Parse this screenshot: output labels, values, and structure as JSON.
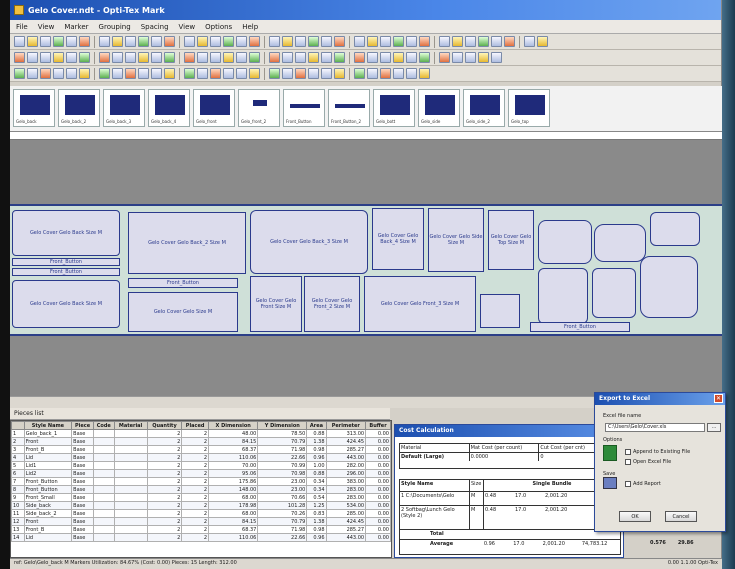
{
  "window": {
    "title": "Gelo Cover.ndt - Opti-Tex Mark"
  },
  "menu": [
    "File",
    "View",
    "Marker",
    "Grouping",
    "Spacing",
    "View",
    "Options",
    "Help"
  ],
  "thumbnails": [
    "Gelo_back",
    "Gelo_back_2",
    "Gelo_back_3",
    "Gelo_back_4",
    "Gelo_front",
    "Gelo_front_2",
    "Front_Button",
    "Front_Button_2",
    "Gelo_bott",
    "Gelo_side",
    "Gelo_side_2",
    "Gelo_top"
  ],
  "pieces": [
    {
      "label": "Gelo Cover Gelo Back Size M"
    },
    {
      "label": "Gelo Cover Gelo Back Size M"
    },
    {
      "label": "Gelo Cover Gelo Back_2 Size M"
    },
    {
      "label": "Gelo Cover Gelo Back_3 Size M"
    },
    {
      "label": "Gelo Cover Gelo Back_4 Size M"
    },
    {
      "label": "Front_Button"
    },
    {
      "label": "Front_Button"
    },
    {
      "label": "Gelo Cover Gelo Size M"
    },
    {
      "label": "Gelo Cover Gelo Front Size M"
    },
    {
      "label": "Gelo Cover Gelo Front_2 Size M"
    },
    {
      "label": "Gelo Cover Gelo Front_3 Size M"
    },
    {
      "label": "Gelo Cover Gelo Side Size M"
    },
    {
      "label": "Gelo Cover Gelo Top Size M"
    },
    {
      "label": "Front_Button"
    },
    {
      "label": "Front_Button"
    }
  ],
  "panel_title": "Pieces list",
  "grid": {
    "headers": [
      "",
      "Style Name",
      "Piece",
      "Code",
      "Material",
      "Quantity",
      "Placed",
      "X Dimension",
      "Y Dimension",
      "Area",
      "Perimeter",
      "Buffer"
    ],
    "rows": [
      [
        "1",
        "Gelo_back_1",
        "Base",
        "",
        "",
        "2",
        "2",
        "48.00",
        "78.50",
        "0.88",
        "313.00",
        "0.00"
      ],
      [
        "2",
        "Front",
        "Base",
        "",
        "",
        "2",
        "2",
        "84.15",
        "70.79",
        "1.38",
        "424.45",
        "0.00"
      ],
      [
        "3",
        "Front_B",
        "Base",
        "",
        "",
        "2",
        "2",
        "68.37",
        "71.98",
        "0.98",
        "285.27",
        "0.00"
      ],
      [
        "4",
        "Lid",
        "Base",
        "",
        "",
        "2",
        "2",
        "110.06",
        "22.66",
        "0.96",
        "443.00",
        "0.00"
      ],
      [
        "5",
        "Lid1",
        "Base",
        "",
        "",
        "2",
        "2",
        "70.00",
        "70.99",
        "1.00",
        "282.00",
        "0.00"
      ],
      [
        "6",
        "Lid2",
        "Base",
        "",
        "",
        "2",
        "2",
        "95.06",
        "70.98",
        "0.88",
        "296.00",
        "0.00"
      ],
      [
        "7",
        "Front_Button",
        "Base",
        "",
        "",
        "2",
        "2",
        "175.86",
        "23.00",
        "0.34",
        "383.00",
        "0.00"
      ],
      [
        "8",
        "Front_Button",
        "Base",
        "",
        "",
        "2",
        "2",
        "148.00",
        "23.00",
        "0.34",
        "283.00",
        "0.00"
      ],
      [
        "9",
        "Front_Small",
        "Base",
        "",
        "",
        "2",
        "2",
        "68.00",
        "70.66",
        "0.54",
        "283.00",
        "0.00"
      ],
      [
        "10",
        "Side_back",
        "Base",
        "",
        "",
        "2",
        "2",
        "178.98",
        "101.28",
        "1.25",
        "534.00",
        "0.00"
      ],
      [
        "11",
        "Side_back_2",
        "Base",
        "",
        "",
        "2",
        "2",
        "68.00",
        "70.26",
        "0.83",
        "285.00",
        "0.00"
      ],
      [
        "12",
        "Front",
        "Base",
        "",
        "",
        "2",
        "2",
        "84.15",
        "70.79",
        "1.38",
        "424.45",
        "0.00"
      ],
      [
        "13",
        "Front_B",
        "Base",
        "",
        "",
        "2",
        "2",
        "68.37",
        "71.98",
        "0.98",
        "285.27",
        "0.00"
      ],
      [
        "14",
        "Lid",
        "Base",
        "",
        "",
        "2",
        "2",
        "110.06",
        "22.66",
        "0.96",
        "443.00",
        "0.00"
      ]
    ]
  },
  "cost": {
    "title": "Cost Calculation",
    "header_cells": [
      "Material",
      "Mat Cost (per count)",
      "Cut Cost (per cnt)"
    ],
    "value_cells": [
      "Default (Large)",
      "0.0000",
      "0"
    ],
    "table_headers": [
      "Style Name",
      "Size",
      "Single Bundle",
      "Mat Area",
      "Mat Cost",
      "Cut Length",
      "Cut Cost",
      "Total"
    ],
    "rows": [
      [
        "1 C:\\Documents\\Gelo",
        "M",
        "0.48",
        "17.0",
        "2,001.20"
      ],
      [
        "2 Softbag\\Lunch Gelo (Style 2)",
        "M",
        "0.48",
        "17.0",
        "2,001.20"
      ]
    ],
    "total_label": "Total",
    "average_label": "Average",
    "average_values": [
      "0.96",
      "17.0",
      "2,001.20",
      "74,783.12"
    ],
    "side_values": [
      "0.576",
      "29.86"
    ]
  },
  "export_dialog": {
    "title": "Export to Excel",
    "file_label": "Excel file name",
    "file_value": "C:\\Users\\Gelo\\Cover.xls",
    "browse": "...",
    "options_label": "Options",
    "opt1": "Append to Existing File",
    "opt2": "Open Excel File",
    "save_label": "Save",
    "opt3": "Add Report",
    "ok": "OK",
    "cancel": "Cancel"
  },
  "status": {
    "left": "ref: Gelo\\Gelo_back M Markers Utilization: 84.67% (Cost: 0.00) Pieces: 15 Length: 312.00",
    "right": "0.00  1.1.00  Opti-Tex"
  }
}
